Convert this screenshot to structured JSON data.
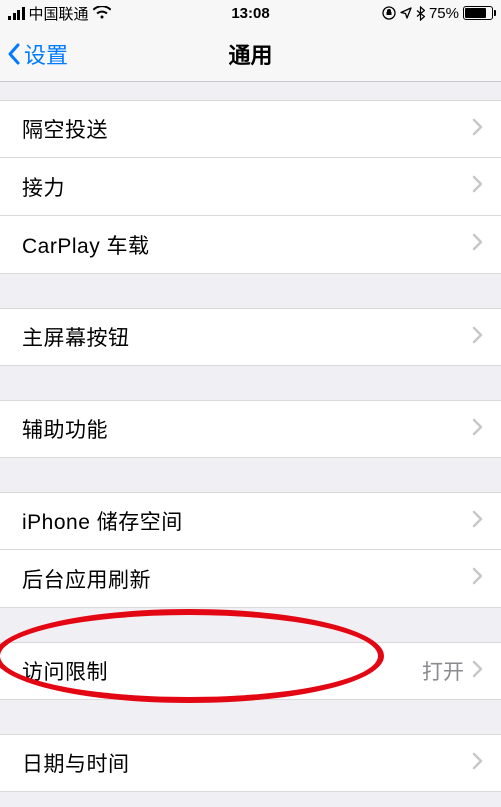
{
  "status": {
    "carrier": "中国联通",
    "time": "13:08",
    "battery_pct": "75%"
  },
  "nav": {
    "back_label": "设置",
    "title": "通用"
  },
  "rows": {
    "airdrop": "隔空投送",
    "handoff": "接力",
    "carplay": "CarPlay 车载",
    "home_button": "主屏幕按钮",
    "accessibility": "辅助功能",
    "storage": "iPhone 储存空间",
    "background_refresh": "后台应用刷新",
    "restrictions": "访问限制",
    "restrictions_value": "打开",
    "date_time": "日期与时间"
  }
}
